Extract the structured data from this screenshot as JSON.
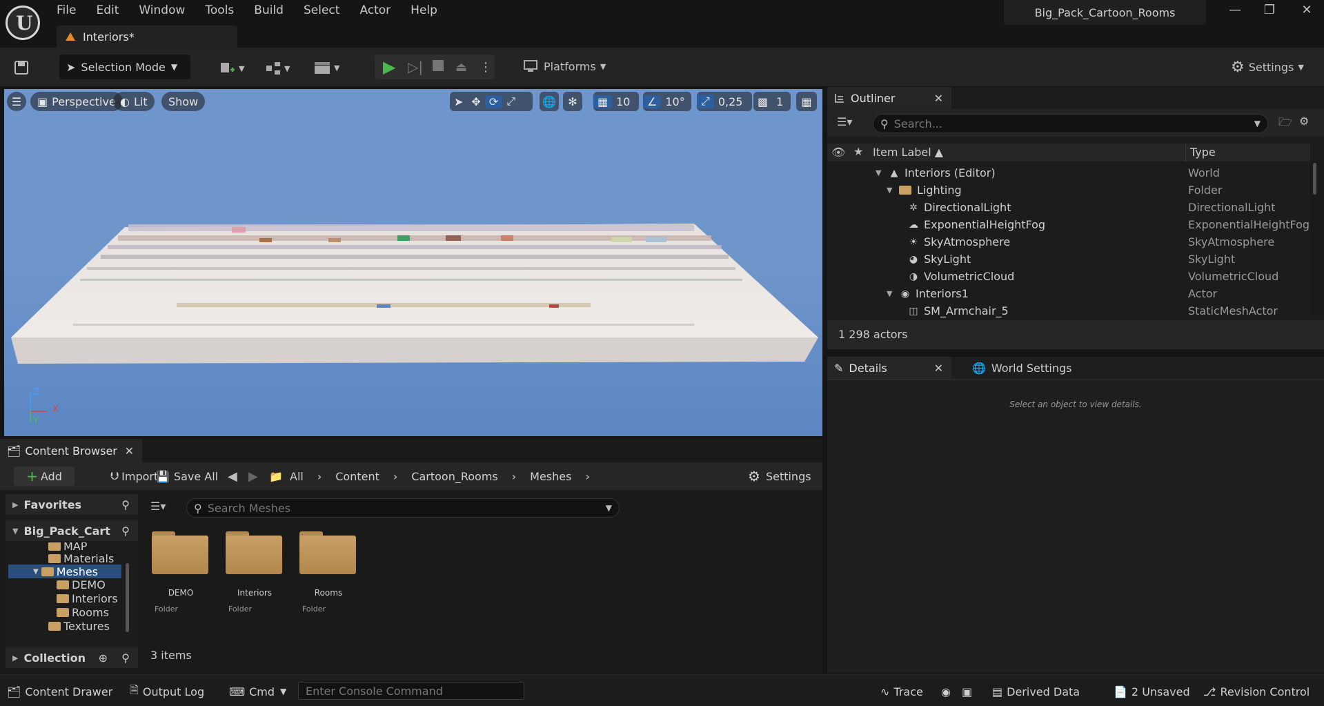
{
  "app": {
    "project_name": "Big_Pack_Cartoon_Rooms",
    "document_tab": "Interiors*",
    "window_controls": [
      "minimize-icon",
      "restore-icon",
      "close-icon"
    ]
  },
  "menu": [
    "File",
    "Edit",
    "Window",
    "Tools",
    "Build",
    "Select",
    "Actor",
    "Help"
  ],
  "toolbar": {
    "selection_mode": "Selection Mode",
    "platforms": "Platforms",
    "settings": "Settings"
  },
  "viewport": {
    "perspective": "Perspective",
    "lit": "Lit",
    "show": "Show",
    "grid_snap": "10",
    "rotation_snap": "10°",
    "scale_snap": "0,25",
    "camera_speed": "1",
    "axis_z": "Z",
    "axis_x": "X",
    "axis_y": "Y"
  },
  "outliner": {
    "tab_label": "Outliner",
    "search_placeholder": "Search...",
    "col_label": "Item Label",
    "col_type": "Type",
    "rows": [
      {
        "label": "Interiors (Editor)",
        "type": "World"
      },
      {
        "label": "Lighting",
        "type": "Folder"
      },
      {
        "label": "DirectionalLight",
        "type": "DirectionalLight"
      },
      {
        "label": "ExponentialHeightFog",
        "type": "ExponentialHeightFog"
      },
      {
        "label": "SkyAtmosphere",
        "type": "SkyAtmosphere"
      },
      {
        "label": "SkyLight",
        "type": "SkyLight"
      },
      {
        "label": "VolumetricCloud",
        "type": "VolumetricCloud"
      },
      {
        "label": "Interiors1",
        "type": "Actor"
      },
      {
        "label": "SM_Armchair_5",
        "type": "StaticMeshActor"
      }
    ],
    "actor_count": "1 298 actors"
  },
  "details": {
    "tab_label": "Details",
    "world_settings_tab": "World Settings",
    "empty_message": "Select an object to view details."
  },
  "content_browser": {
    "tab_label": "Content Browser",
    "add": "Add",
    "import": "Import",
    "save_all": "Save All",
    "breadcrumb": [
      "All",
      "Content",
      "Cartoon_Rooms",
      "Meshes"
    ],
    "settings": "Settings",
    "favorites": "Favorites",
    "root": "Big_Pack_Cart",
    "tree": [
      "MAP",
      "Materials",
      "Meshes",
      "DEMO",
      "Interiors",
      "Rooms",
      "Textures"
    ],
    "collection": "Collection",
    "search_placeholder": "Search Meshes",
    "assets": [
      {
        "name": "DEMO",
        "kind": "Folder"
      },
      {
        "name": "Interiors",
        "kind": "Folder"
      },
      {
        "name": "Rooms",
        "kind": "Folder"
      }
    ],
    "item_count": "3 items"
  },
  "statusbar": {
    "content_drawer": "Content Drawer",
    "output_log": "Output Log",
    "cmd": "Cmd",
    "console_placeholder": "Enter Console Command",
    "trace": "Trace",
    "derived_data": "Derived Data",
    "unsaved": "2 Unsaved",
    "revision_control": "Revision Control"
  }
}
